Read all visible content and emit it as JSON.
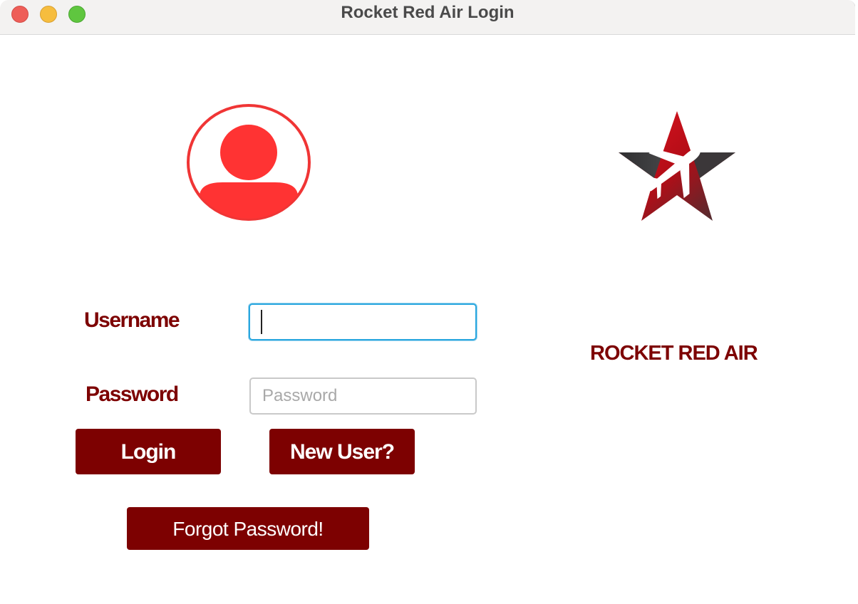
{
  "window": {
    "title": "Rocket Red Air Login",
    "controls": [
      "close",
      "minimize",
      "maximize"
    ]
  },
  "branding": {
    "name": "ROCKET RED AIR",
    "logo_icon": "star-airplane-icon",
    "avatar_icon": "user-avatar-icon"
  },
  "form": {
    "username_label": "Username",
    "username_value": "",
    "username_placeholder": "",
    "password_label": "Password",
    "password_value": "",
    "password_placeholder": "Password"
  },
  "buttons": {
    "login": "Login",
    "new_user": "New User?",
    "forgot_password": "Forgot Password!"
  },
  "colors": {
    "accent": "#7d0101",
    "avatar_red": "#ff3333",
    "focus_ring": "#2aa7df"
  }
}
